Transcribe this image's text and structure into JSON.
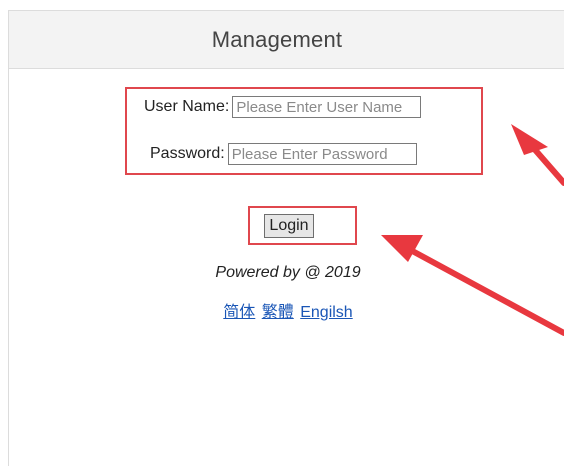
{
  "header": {
    "title": "Management"
  },
  "form": {
    "username_label": "User Name:",
    "username_placeholder": "Please Enter User Name",
    "password_label": "Password:",
    "password_placeholder": "Please Enter Password"
  },
  "login_label": "Login",
  "footer": {
    "powered_text": "Powered by @ 2019",
    "links": [
      "简体",
      "繁體",
      "Engilsh"
    ]
  },
  "colors": {
    "annotation": "#e0474d",
    "link": "#1a56b6",
    "header_bg": "#f3f3f3"
  },
  "icons": [
    "arrow-pointer-icon",
    "arrow-pointer-icon"
  ]
}
